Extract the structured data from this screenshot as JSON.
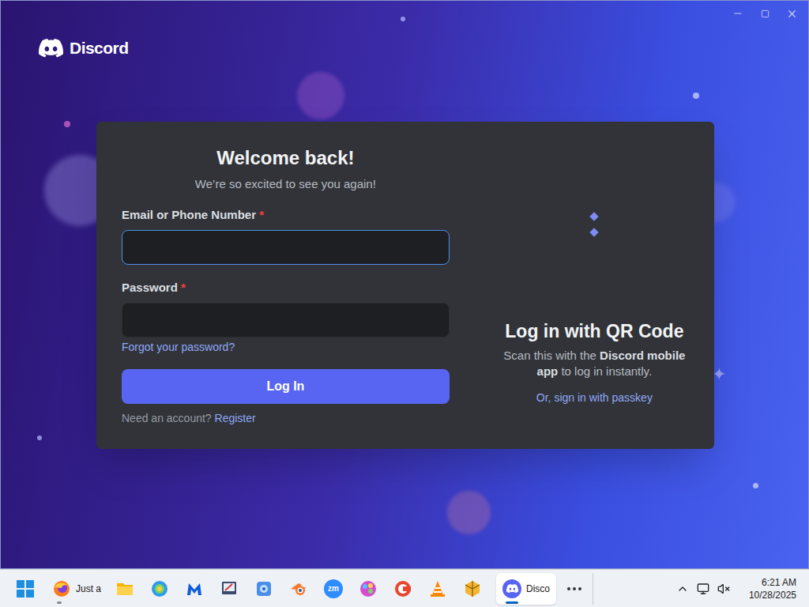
{
  "brand": {
    "name": "Discord"
  },
  "login": {
    "title": "Welcome back!",
    "subtitle": "We’re so excited to see you again!",
    "fields": [
      {
        "label": "Email or Phone Number",
        "required_mark": "*",
        "value": "",
        "focused": true,
        "kind": "text"
      },
      {
        "label": "Password",
        "required_mark": "*",
        "value": "",
        "focused": false,
        "kind": "password"
      }
    ],
    "forgot_link": "Forgot your password?",
    "submit": "Log In",
    "register_prompt": "Need an account?",
    "register_link": "Register"
  },
  "qr": {
    "loading": true,
    "title": "Log in with QR Code",
    "text_before": "Scan this with the ",
    "text_bold": "Discord mobile app",
    "text_after": " to log in instantly.",
    "passkey_link": "Or, sign in with passkey"
  },
  "taskbar": {
    "apps": [
      {
        "kind": "firefox",
        "label": "Just a",
        "running": true,
        "active": false
      },
      {
        "kind": "folder",
        "running": false,
        "active": false
      },
      {
        "kind": "edge",
        "running": false,
        "active": false
      },
      {
        "kind": "malwarebytes",
        "running": false,
        "active": false
      },
      {
        "kind": "remote",
        "running": false,
        "active": false
      },
      {
        "kind": "network",
        "running": false,
        "active": false
      },
      {
        "kind": "blender",
        "running": false,
        "active": false
      },
      {
        "kind": "zoom",
        "icon_text": "zm",
        "running": false,
        "active": false
      },
      {
        "kind": "paint",
        "running": false,
        "active": false
      },
      {
        "kind": "ccleaner",
        "running": false,
        "active": false
      },
      {
        "kind": "vlc",
        "running": false,
        "active": false
      },
      {
        "kind": "archive",
        "running": false,
        "active": false
      },
      {
        "kind": "discord",
        "label": "Disco",
        "running": true,
        "active": true
      }
    ],
    "time": "6:21 AM",
    "date": "10/28/2025"
  }
}
